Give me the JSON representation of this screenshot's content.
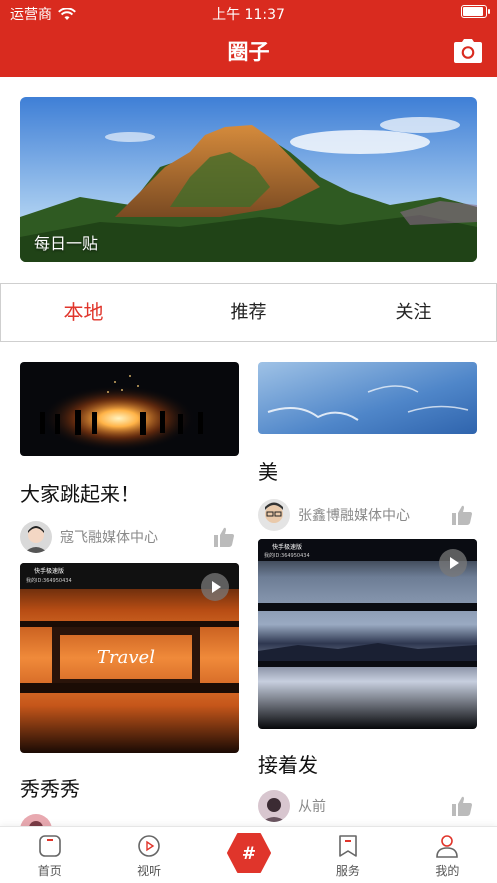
{
  "status_bar": {
    "carrier": "运营商",
    "time": "上午 11:37",
    "battery_level": 1.0
  },
  "header": {
    "title": "圈子",
    "camera_icon": "camera-icon"
  },
  "banner": {
    "caption": "每日一贴"
  },
  "tabs": [
    {
      "label": "本地",
      "active": true
    },
    {
      "label": "推荐",
      "active": false
    },
    {
      "label": "关注",
      "active": false
    }
  ],
  "feed": {
    "left": [
      {
        "title": "大家跳起来！",
        "author": "寇飞融媒体中心",
        "is_video": false
      },
      {
        "title": "秀秀秀",
        "author": "",
        "is_video": true,
        "video_watermark": "快手极速版",
        "video_id": "我的ID:364950434"
      }
    ],
    "right": [
      {
        "title": "美",
        "author": "张鑫博融媒体中心",
        "is_video": false
      },
      {
        "title": "接着发",
        "author": "从前",
        "is_video": true,
        "video_watermark": "快手极速版",
        "video_id": "我的ID:364950434"
      }
    ]
  },
  "bottom_nav": [
    {
      "label": "首页",
      "icon": "home-icon"
    },
    {
      "label": "视听",
      "icon": "play-circle-icon"
    },
    {
      "label": "",
      "icon": "hashtag-icon"
    },
    {
      "label": "服务",
      "icon": "bookmark-icon"
    },
    {
      "label": "我的",
      "icon": "user-icon"
    }
  ],
  "colors": {
    "brand_red": "#d92b1f",
    "active_tab": "#e0352b"
  }
}
